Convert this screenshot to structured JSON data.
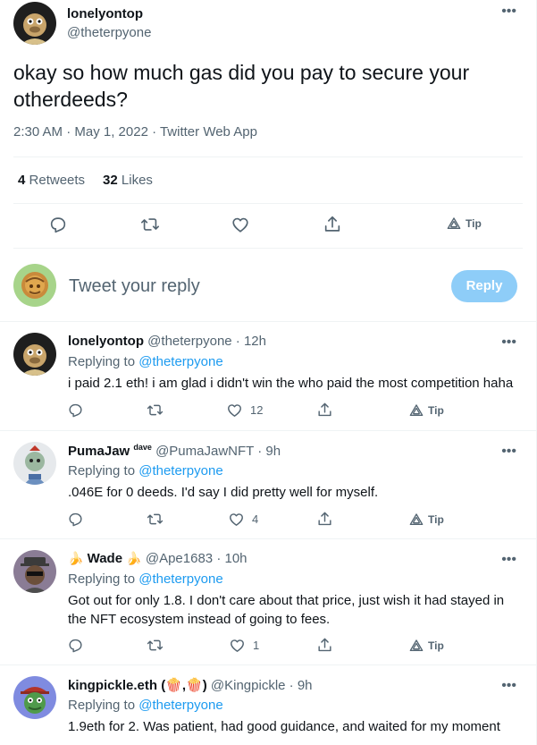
{
  "main_tweet": {
    "author_name": "lonelyontop",
    "author_handle": "@theterpyone",
    "text": "okay so how much gas did you pay to secure your otherdeeds?",
    "meta": "2:30 AM · May 1, 2022 · Twitter Web App",
    "retweets_count": "4",
    "retweets_label": "Retweets",
    "likes_count": "32",
    "likes_label": "Likes",
    "tip_label": "Tip"
  },
  "composer": {
    "placeholder": "Tweet your reply",
    "reply_button": "Reply"
  },
  "replies": [
    {
      "name": "lonelyontop",
      "handle": "@theterpyone",
      "time": "· 12h",
      "replying_label": "Replying to",
      "replying_to": "@theterpyone",
      "text": "i paid 2.1 eth! i am glad i didn't win the who paid the most competition haha",
      "like_count": "12",
      "tip_label": "Tip"
    },
    {
      "name": "PumaJaw",
      "name_suffix": "dave",
      "handle": "@PumaJawNFT",
      "time": "· 9h",
      "replying_label": "Replying to",
      "replying_to": "@theterpyone",
      "text": ".046E for 0 deeds. I'd say I did pretty well for myself.",
      "like_count": "4",
      "tip_label": "Tip"
    },
    {
      "name": "Wade",
      "name_prefix_emoji": "🍌",
      "name_suffix_emoji": "🍌",
      "handle": "@Ape1683",
      "time": "· 10h",
      "replying_label": "Replying to",
      "replying_to": "@theterpyone",
      "text": "Got out for only 1.8. I don't care about that price, just wish it had stayed in the NFT ecosystem instead of going to fees.",
      "like_count": "1",
      "tip_label": "Tip"
    },
    {
      "name": "kingpickle.eth",
      "name_suffix_text": "(🍿,🍿)",
      "handle": "@Kingpickle",
      "time": "· 9h",
      "replying_label": "Replying to",
      "replying_to": "@theterpyone",
      "text": "1.9eth for 2. Was patient, had good guidance, and waited for my moment"
    }
  ],
  "icons": {
    "more": "more-icon",
    "reply": "reply-icon",
    "retweet": "retweet-icon",
    "like": "heart-icon",
    "share": "share-icon",
    "tip": "tip-icon"
  },
  "colors": {
    "accent": "#1d9bf0",
    "reply_button_disabled": "#8ecdf8",
    "secondary_text": "#536471"
  }
}
